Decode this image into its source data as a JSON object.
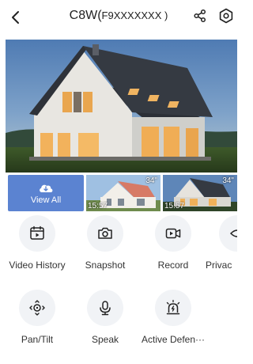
{
  "header": {
    "device_name": "C8W(",
    "serial": " F9XXXXXXX )",
    "icons": {
      "back": "chevron-left-icon",
      "share": "share-icon",
      "settings": "settings-icon"
    }
  },
  "live_view": {
    "scene": "house-dusk-image"
  },
  "playback": {
    "view_all_label": "View All",
    "clips": [
      {
        "time": "15:57",
        "duration": "34\""
      },
      {
        "time": "15:57",
        "duration": "34\""
      }
    ]
  },
  "functions": [
    {
      "label": "Video History",
      "icon": "calendar-video-icon"
    },
    {
      "label": "Snapshot",
      "icon": "camera-icon"
    },
    {
      "label": "Record",
      "icon": "record-video-icon"
    },
    {
      "label": "Privac",
      "icon": "privacy-eye-icon"
    },
    {
      "label": "Pan/Tilt",
      "icon": "pan-tilt-icon"
    },
    {
      "label": "Speak",
      "icon": "microphone-icon"
    },
    {
      "label": "Active Defen···",
      "icon": "alarm-light-icon"
    }
  ],
  "colors": {
    "accent": "#5b83d1",
    "icon_bg": "#f1f3f6",
    "icon_stroke": "#222222"
  }
}
